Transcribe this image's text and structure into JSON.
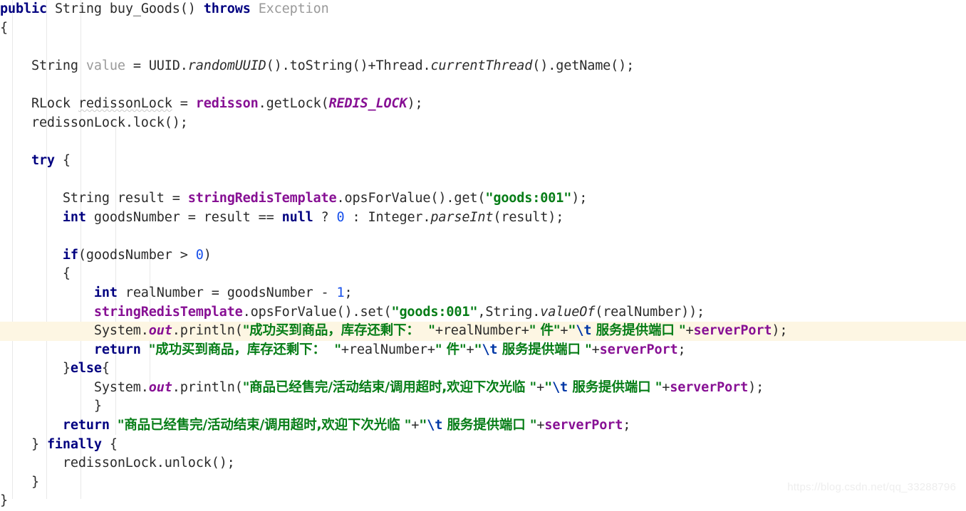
{
  "editor": {
    "language": "java",
    "background_color": "#ffffff",
    "highlight_color": "#fdf6e3",
    "guide_color": "#e8e8e8",
    "indent_guide_x": [
      17,
      65,
      113,
      162,
      210
    ],
    "highlighted_line_number": 16
  },
  "watermark": {
    "text": "https://blog.csdn.net/qq_33288796",
    "color": "#eeeeee"
  },
  "colors": {
    "keyword": "#000080",
    "field": "#871094",
    "string": "#067d17",
    "number": "#1750eb",
    "escape": "#0037a6",
    "grayed_out": "#9a9a9a",
    "default_text": "#2b2b2b"
  },
  "code": {
    "lines": [
      {
        "n": 1,
        "t": "method-signature",
        "text": "public String buy_Goods() throws Exception"
      },
      {
        "n": 2,
        "t": "open-brace",
        "text": "{"
      },
      {
        "n": 3,
        "t": "blank",
        "text": ""
      },
      {
        "n": 4,
        "t": "uuid-value-statement",
        "text": "    String value = UUID.randomUUID().toString()+Thread.currentThread().getName();"
      },
      {
        "n": 5,
        "t": "blank",
        "text": ""
      },
      {
        "n": 6,
        "t": "get-lock-statement",
        "text": "    RLock redissonLock = redisson.getLock(REDIS_LOCK);"
      },
      {
        "n": 7,
        "t": "lock-call",
        "text": "    redissonLock.lock();"
      },
      {
        "n": 8,
        "t": "blank",
        "text": ""
      },
      {
        "n": 9,
        "t": "try-open",
        "text": "    try {"
      },
      {
        "n": 10,
        "t": "blank",
        "text": ""
      },
      {
        "n": 11,
        "t": "get-result",
        "text": "        String result = stringRedisTemplate.opsForValue().get(\"goods:001\");"
      },
      {
        "n": 12,
        "t": "parse-goods-number",
        "text": "        int goodsNumber = result == null ? 0 : Integer.parseInt(result);"
      },
      {
        "n": 13,
        "t": "blank",
        "text": ""
      },
      {
        "n": 14,
        "t": "if-condition",
        "text": "        if(goodsNumber > 0)"
      },
      {
        "n": 15,
        "t": "if-open-brace",
        "text": "        {"
      },
      {
        "n": 16,
        "t": "decrement-stock",
        "text": "            int realNumber = goodsNumber - 1;"
      },
      {
        "n": 17,
        "t": "set-redis-value",
        "text": "            stringRedisTemplate.opsForValue().set(\"goods:001\",String.valueOf(realNumber));"
      },
      {
        "n": 18,
        "t": "println-success",
        "text": "            System.out.println(\"成功买到商品，库存还剩下：  \"+realNumber+\" 件\"+\"\\t 服务提供端口 \"+serverPort);"
      },
      {
        "n": 19,
        "t": "return-success",
        "text": "            return \"成功买到商品，库存还剩下：  \"+realNumber+\" 件\"+\"\\t 服务提供端口 \"+serverPort;"
      },
      {
        "n": 20,
        "t": "else-open",
        "text": "        }else{"
      },
      {
        "n": 21,
        "t": "println-soldout",
        "text": "            System.out.println(\"商品已经售完/活动结束/调用超时,欢迎下次光临 \"+\"\\t 服务提供端口 \"+serverPort);"
      },
      {
        "n": 22,
        "t": "else-close-brace",
        "text": "        }"
      },
      {
        "n": 23,
        "t": "return-soldout",
        "text": "        return \"商品已经售完/活动结束/调用超时,欢迎下次光临 \"+\"\\t 服务提供端口 \"+serverPort;"
      },
      {
        "n": 24,
        "t": "finally-open",
        "text": "    } finally {"
      },
      {
        "n": 25,
        "t": "unlock-call",
        "text": "        redissonLock.unlock();"
      },
      {
        "n": 26,
        "t": "finally-close-brace",
        "text": "    }"
      },
      {
        "n": 27,
        "t": "method-close-brace",
        "text": "}"
      }
    ],
    "strings": {
      "goods_key": "goods:001",
      "success_message": "成功买到商品，库存还剩下：  ",
      "piece_unit": " 件",
      "port_label": "\\t 服务提供端口 ",
      "soldout_message": "商品已经售完/活动结束/调用超时,欢迎下次光临 "
    },
    "identifiers": {
      "method_name": "buy_Goods",
      "lock_constant": "REDIS_LOCK",
      "lock_variable": "redissonLock",
      "redis_template": "stringRedisTemplate",
      "redisson_client": "redisson",
      "server_port": "serverPort",
      "goods_number": "goodsNumber",
      "real_number": "realNumber",
      "result_var": "result",
      "value_var": "value"
    }
  }
}
